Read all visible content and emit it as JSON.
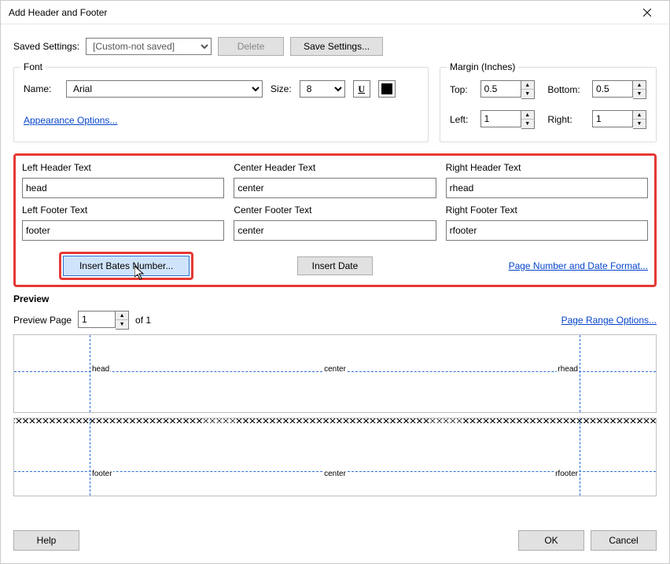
{
  "window": {
    "title": "Add Header and Footer"
  },
  "savedSettings": {
    "label": "Saved Settings:",
    "value": "[Custom-not saved]",
    "deleteLabel": "Delete",
    "saveLabel": "Save Settings..."
  },
  "font": {
    "groupLabel": "Font",
    "nameLabel": "Name:",
    "nameValue": "Arial",
    "sizeLabel": "Size:",
    "sizeValue": "8",
    "underlineGlyph": "U",
    "appearanceLink": "Appearance Options..."
  },
  "margin": {
    "groupLabel": "Margin (Inches)",
    "topLabel": "Top:",
    "topValue": "0.5",
    "bottomLabel": "Bottom:",
    "bottomValue": "0.5",
    "leftLabel": "Left:",
    "leftValue": "1",
    "rightLabel": "Right:",
    "rightValue": "1"
  },
  "headersFooters": {
    "leftHeaderLabel": "Left Header Text",
    "centerHeaderLabel": "Center Header Text",
    "rightHeaderLabel": "Right Header Text",
    "leftFooterLabel": "Left Footer Text",
    "centerFooterLabel": "Center Footer Text",
    "rightFooterLabel": "Right Footer Text",
    "leftHeader": "head",
    "centerHeader": "center",
    "rightHeader": "rhead",
    "leftFooter": "footer",
    "centerFooter": "center",
    "rightFooter": "rfooter",
    "insertBatesLabel": "Insert Bates Number...",
    "insertDateLabel": "Insert Date",
    "pageNumberFormatLink": "Page Number and Date Format..."
  },
  "preview": {
    "groupLabel": "Preview",
    "pageLabel": "Preview Page",
    "pageValue": "1",
    "ofLabel": "of 1",
    "pageRangeLink": "Page Range Options...",
    "headerLeft": "head",
    "headerCenter": "center",
    "headerRight": "rhead",
    "footerLeft": "footer",
    "footerCenter": "center",
    "footerRight": "rfooter"
  },
  "buttons": {
    "help": "Help",
    "ok": "OK",
    "cancel": "Cancel"
  }
}
